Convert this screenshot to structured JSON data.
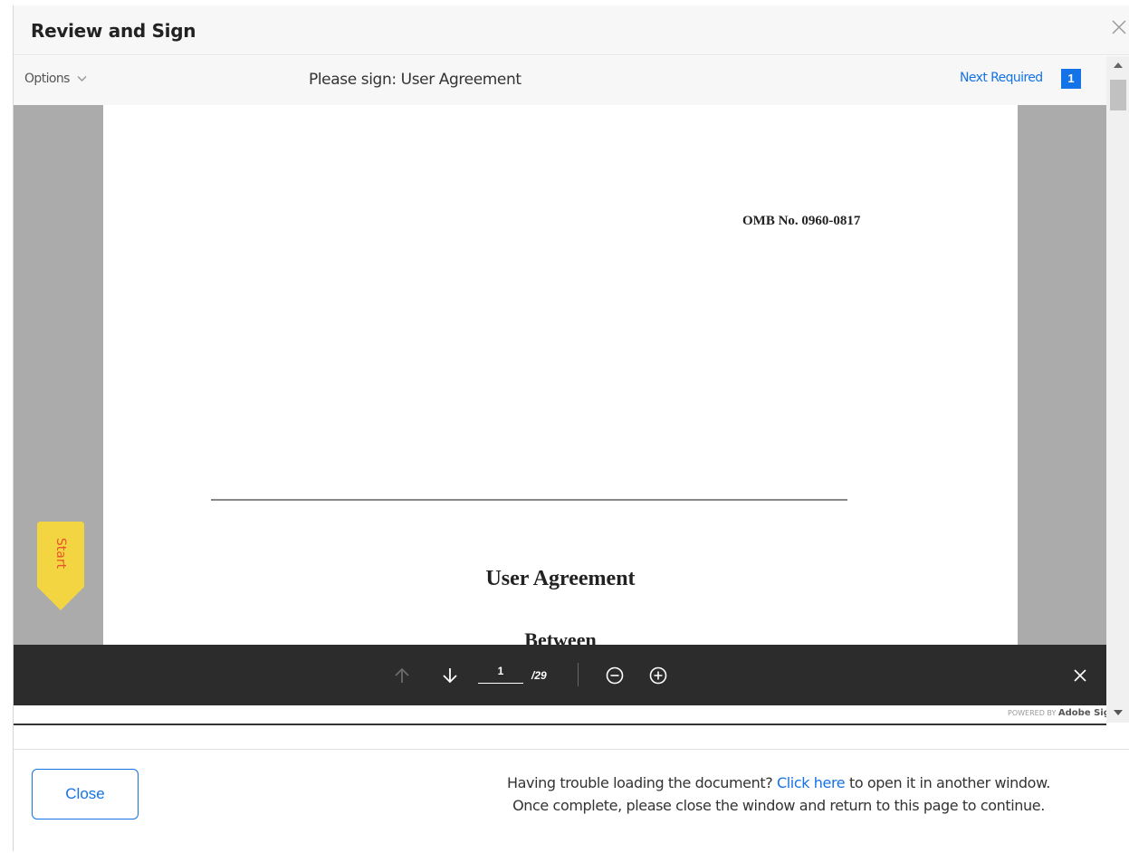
{
  "modal": {
    "title": "Review and Sign",
    "close_icon": "close-icon"
  },
  "toolbar": {
    "options_label": "Options",
    "options_icon": "chevron-down-icon",
    "document_title": "Please sign: User Agreement",
    "next_required_label": "Next Required",
    "next_required_count": "1"
  },
  "document": {
    "omb_number": "OMB No. 0960-0817",
    "heading": "User Agreement",
    "subheading": "Between",
    "start_tag_label": "Start"
  },
  "pager": {
    "current_page": "1",
    "total_pages": "/29",
    "icons": [
      "arrow-up-icon",
      "arrow-down-icon",
      "zoom-out-icon",
      "zoom-in-icon",
      "close-icon"
    ]
  },
  "branding": {
    "powered_prefix": "POWERED BY",
    "brand": "Adobe Sign"
  },
  "footer": {
    "close_button_label": "Close",
    "trouble_text_before": "Having trouble loading the document? ",
    "trouble_link": "Click here",
    "trouble_text_after": " to open it in another window.",
    "trouble_line2": "Once complete, please close the window and return to this page to continue."
  },
  "colors": {
    "accent": "#1473e6",
    "start_tag_fill": "#f2d541",
    "start_tag_text": "#e8542e",
    "pager_background": "#2c2c2c",
    "document_gutter": "#ababab"
  }
}
